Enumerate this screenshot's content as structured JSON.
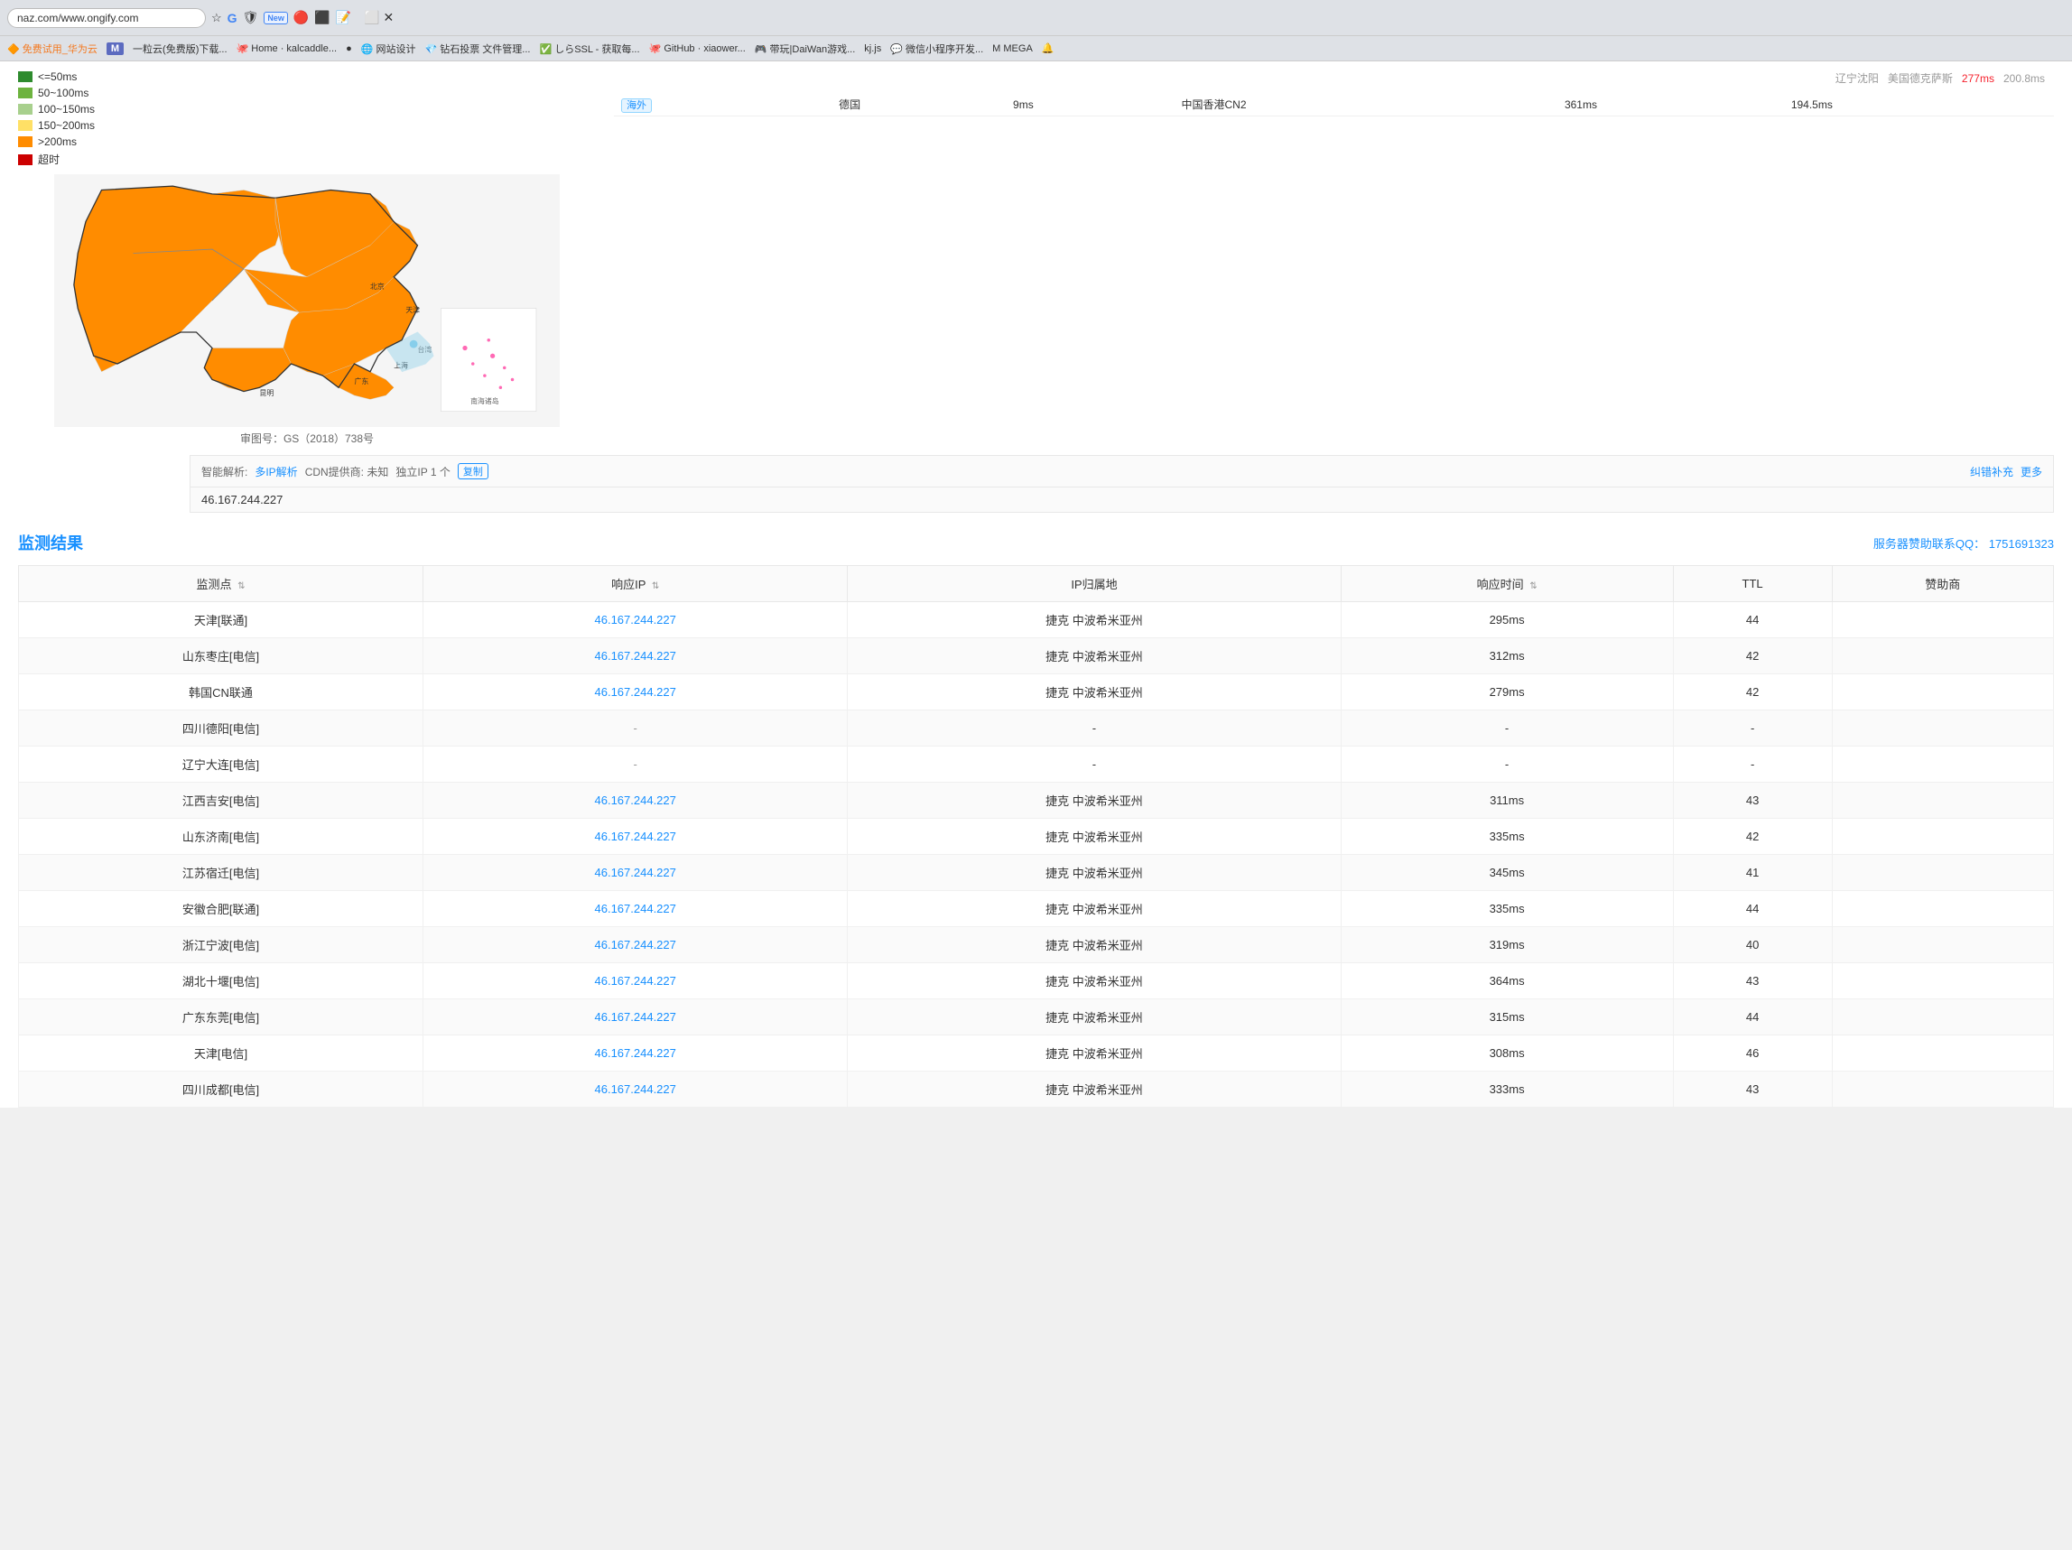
{
  "browser": {
    "url": "naz.com/www.ongify.com",
    "new_badge": "New",
    "bookmarks": [
      {
        "label": "免费试用_华为云",
        "icon": "🔶"
      },
      {
        "label": "M"
      },
      {
        "label": "一粒云(免费版)下载..."
      },
      {
        "label": "Home · kalcaddle..."
      },
      {
        "label": "●"
      },
      {
        "label": "网站设计"
      },
      {
        "label": "钻石投票 文件管理..."
      },
      {
        "label": "しらSSL - 获取每..."
      },
      {
        "label": "GitHub · xiaower..."
      },
      {
        "label": "带玩|DaiWan游戏..."
      },
      {
        "label": "kj.js"
      },
      {
        "label": "微信小程序开发..."
      },
      {
        "label": "M MEGA"
      },
      {
        "label": "🔔"
      }
    ]
  },
  "legend": {
    "items": [
      {
        "color": "#2e8b2e",
        "label": "<=50ms"
      },
      {
        "color": "#6db33f",
        "label": "50~100ms"
      },
      {
        "color": "#a8d08d",
        "label": "100~150ms"
      },
      {
        "color": "#ffe066",
        "label": "150~200ms"
      },
      {
        "color": "#ff8c00",
        "label": ">200ms"
      },
      {
        "color": "#cc0000",
        "label": "超时"
      }
    ]
  },
  "map": {
    "caption": "审图号：GS（2018）738号"
  },
  "overseas_table": {
    "tag": "海外",
    "rows": [
      {
        "region": "德国",
        "ms": "9ms",
        "target": "中国香港CN2",
        "time1": "361ms",
        "time2": "194.5ms"
      }
    ]
  },
  "info_bar": {
    "prefix": "智能解析:",
    "multi_ip": "多IP解析",
    "cdn_provider": "CDN提供商: 未知",
    "independent_ip": "独立IP 1 个",
    "copy_btn": "复制",
    "right_links": [
      "纠错补充",
      "更多"
    ]
  },
  "ip_address": "46.167.244.227",
  "results": {
    "title": "监测结果",
    "contact": "服务器赞助联系QQ：",
    "contact_qq": "1751691323",
    "columns": [
      "监测点",
      "响应IP",
      "IP归属地",
      "响应时间",
      "TTL",
      "赞助商"
    ],
    "rows": [
      {
        "monitor": "天津[联通]",
        "ip": "46.167.244.227",
        "location": "捷克 中波希米亚州",
        "time": "295ms",
        "ttl": "44",
        "sponsor": ""
      },
      {
        "monitor": "山东枣庄[电信]",
        "ip": "46.167.244.227",
        "location": "捷克 中波希米亚州",
        "time": "312ms",
        "ttl": "42",
        "sponsor": ""
      },
      {
        "monitor": "韩国CN联通",
        "ip": "46.167.244.227",
        "location": "捷克 中波希米亚州",
        "time": "279ms",
        "ttl": "42",
        "sponsor": ""
      },
      {
        "monitor": "四川德阳[电信]",
        "ip": "-",
        "location": "-",
        "time": "-",
        "ttl": "-",
        "sponsor": ""
      },
      {
        "monitor": "辽宁大连[电信]",
        "ip": "-",
        "location": "-",
        "time": "-",
        "ttl": "-",
        "sponsor": ""
      },
      {
        "monitor": "江西吉安[电信]",
        "ip": "46.167.244.227",
        "location": "捷克 中波希米亚州",
        "time": "311ms",
        "ttl": "43",
        "sponsor": ""
      },
      {
        "monitor": "山东济南[电信]",
        "ip": "46.167.244.227",
        "location": "捷克 中波希米亚州",
        "time": "335ms",
        "ttl": "42",
        "sponsor": ""
      },
      {
        "monitor": "江苏宿迁[电信]",
        "ip": "46.167.244.227",
        "location": "捷克 中波希米亚州",
        "time": "345ms",
        "ttl": "41",
        "sponsor": ""
      },
      {
        "monitor": "安徽合肥[联通]",
        "ip": "46.167.244.227",
        "location": "捷克 中波希米亚州",
        "time": "335ms",
        "ttl": "44",
        "sponsor": ""
      },
      {
        "monitor": "浙江宁波[电信]",
        "ip": "46.167.244.227",
        "location": "捷克 中波希米亚州",
        "time": "319ms",
        "ttl": "40",
        "sponsor": ""
      },
      {
        "monitor": "湖北十堰[电信]",
        "ip": "46.167.244.227",
        "location": "捷克 中波希米亚州",
        "time": "364ms",
        "ttl": "43",
        "sponsor": ""
      },
      {
        "monitor": "广东东莞[电信]",
        "ip": "46.167.244.227",
        "location": "捷克 中波希米亚州",
        "time": "315ms",
        "ttl": "44",
        "sponsor": ""
      },
      {
        "monitor": "天津[电信]",
        "ip": "46.167.244.227",
        "location": "捷克 中波希米亚州",
        "time": "308ms",
        "ttl": "46",
        "sponsor": ""
      },
      {
        "monitor": "四川成都[电信]",
        "ip": "46.167.244.227",
        "location": "捷克 中波希米亚州",
        "time": "333ms",
        "ttl": "43",
        "sponsor": ""
      }
    ]
  }
}
